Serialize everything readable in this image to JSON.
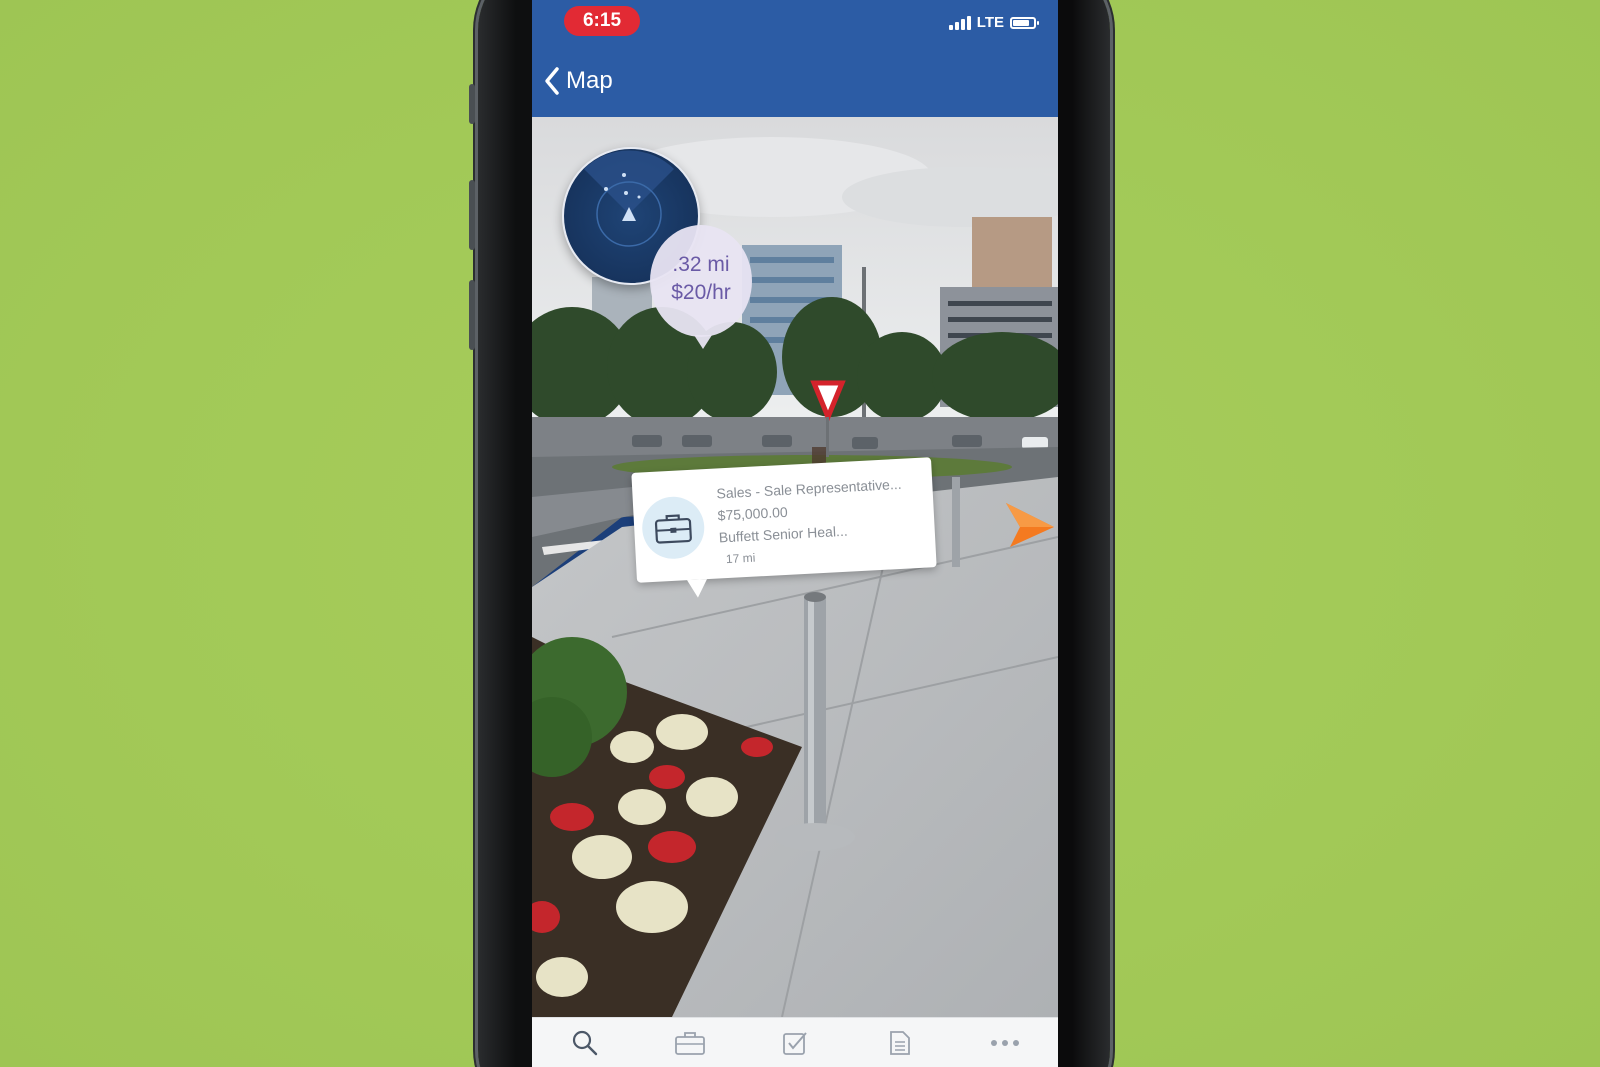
{
  "status_bar": {
    "time": "6:15",
    "network": "LTE"
  },
  "nav": {
    "back_label": "Map",
    "bar_color": "#2c5ca5"
  },
  "price_bubble": {
    "distance": ".32 mi",
    "rate": "$20/hr"
  },
  "job_card": {
    "title": "Sales - Sale Representative...",
    "salary": "$75,000.00",
    "company": "Buffett Senior Heal...",
    "distance": "17 mi",
    "icon": "briefcase-icon"
  },
  "direction_arrow": {
    "color": "#f47a20",
    "icon": "arrow-right-icon"
  },
  "tabs": [
    {
      "icon": "search-icon"
    },
    {
      "icon": "briefcase-icon"
    },
    {
      "icon": "checkbox-icon"
    },
    {
      "icon": "document-icon"
    },
    {
      "icon": "more-icon"
    }
  ]
}
